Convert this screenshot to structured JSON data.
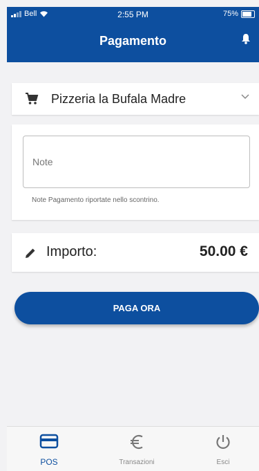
{
  "status_bar": {
    "carrier": "Bell",
    "time": "2:55 PM",
    "battery": "75%"
  },
  "header": {
    "title": "Pagamento",
    "icon": "bell-icon"
  },
  "merchant": {
    "name": "Pizzeria la Bufala Madre",
    "icon": "cart-icon"
  },
  "note": {
    "placeholder": "Note",
    "value": "",
    "hint": "Note Pagamento riportate nello scontrino."
  },
  "amount": {
    "label": "Importo:",
    "value": "50.00 €",
    "icon": "pencil-icon"
  },
  "pay_button": {
    "label": "PAGA ORA"
  },
  "tabs": [
    {
      "label": "POS",
      "icon": "card-icon",
      "active": true
    },
    {
      "label": "Transazioni",
      "icon": "euro-icon",
      "active": false
    },
    {
      "label": "Esci",
      "icon": "power-icon",
      "active": false
    }
  ],
  "colors": {
    "primary": "#0d4f9f",
    "background": "#f2f2f4"
  }
}
